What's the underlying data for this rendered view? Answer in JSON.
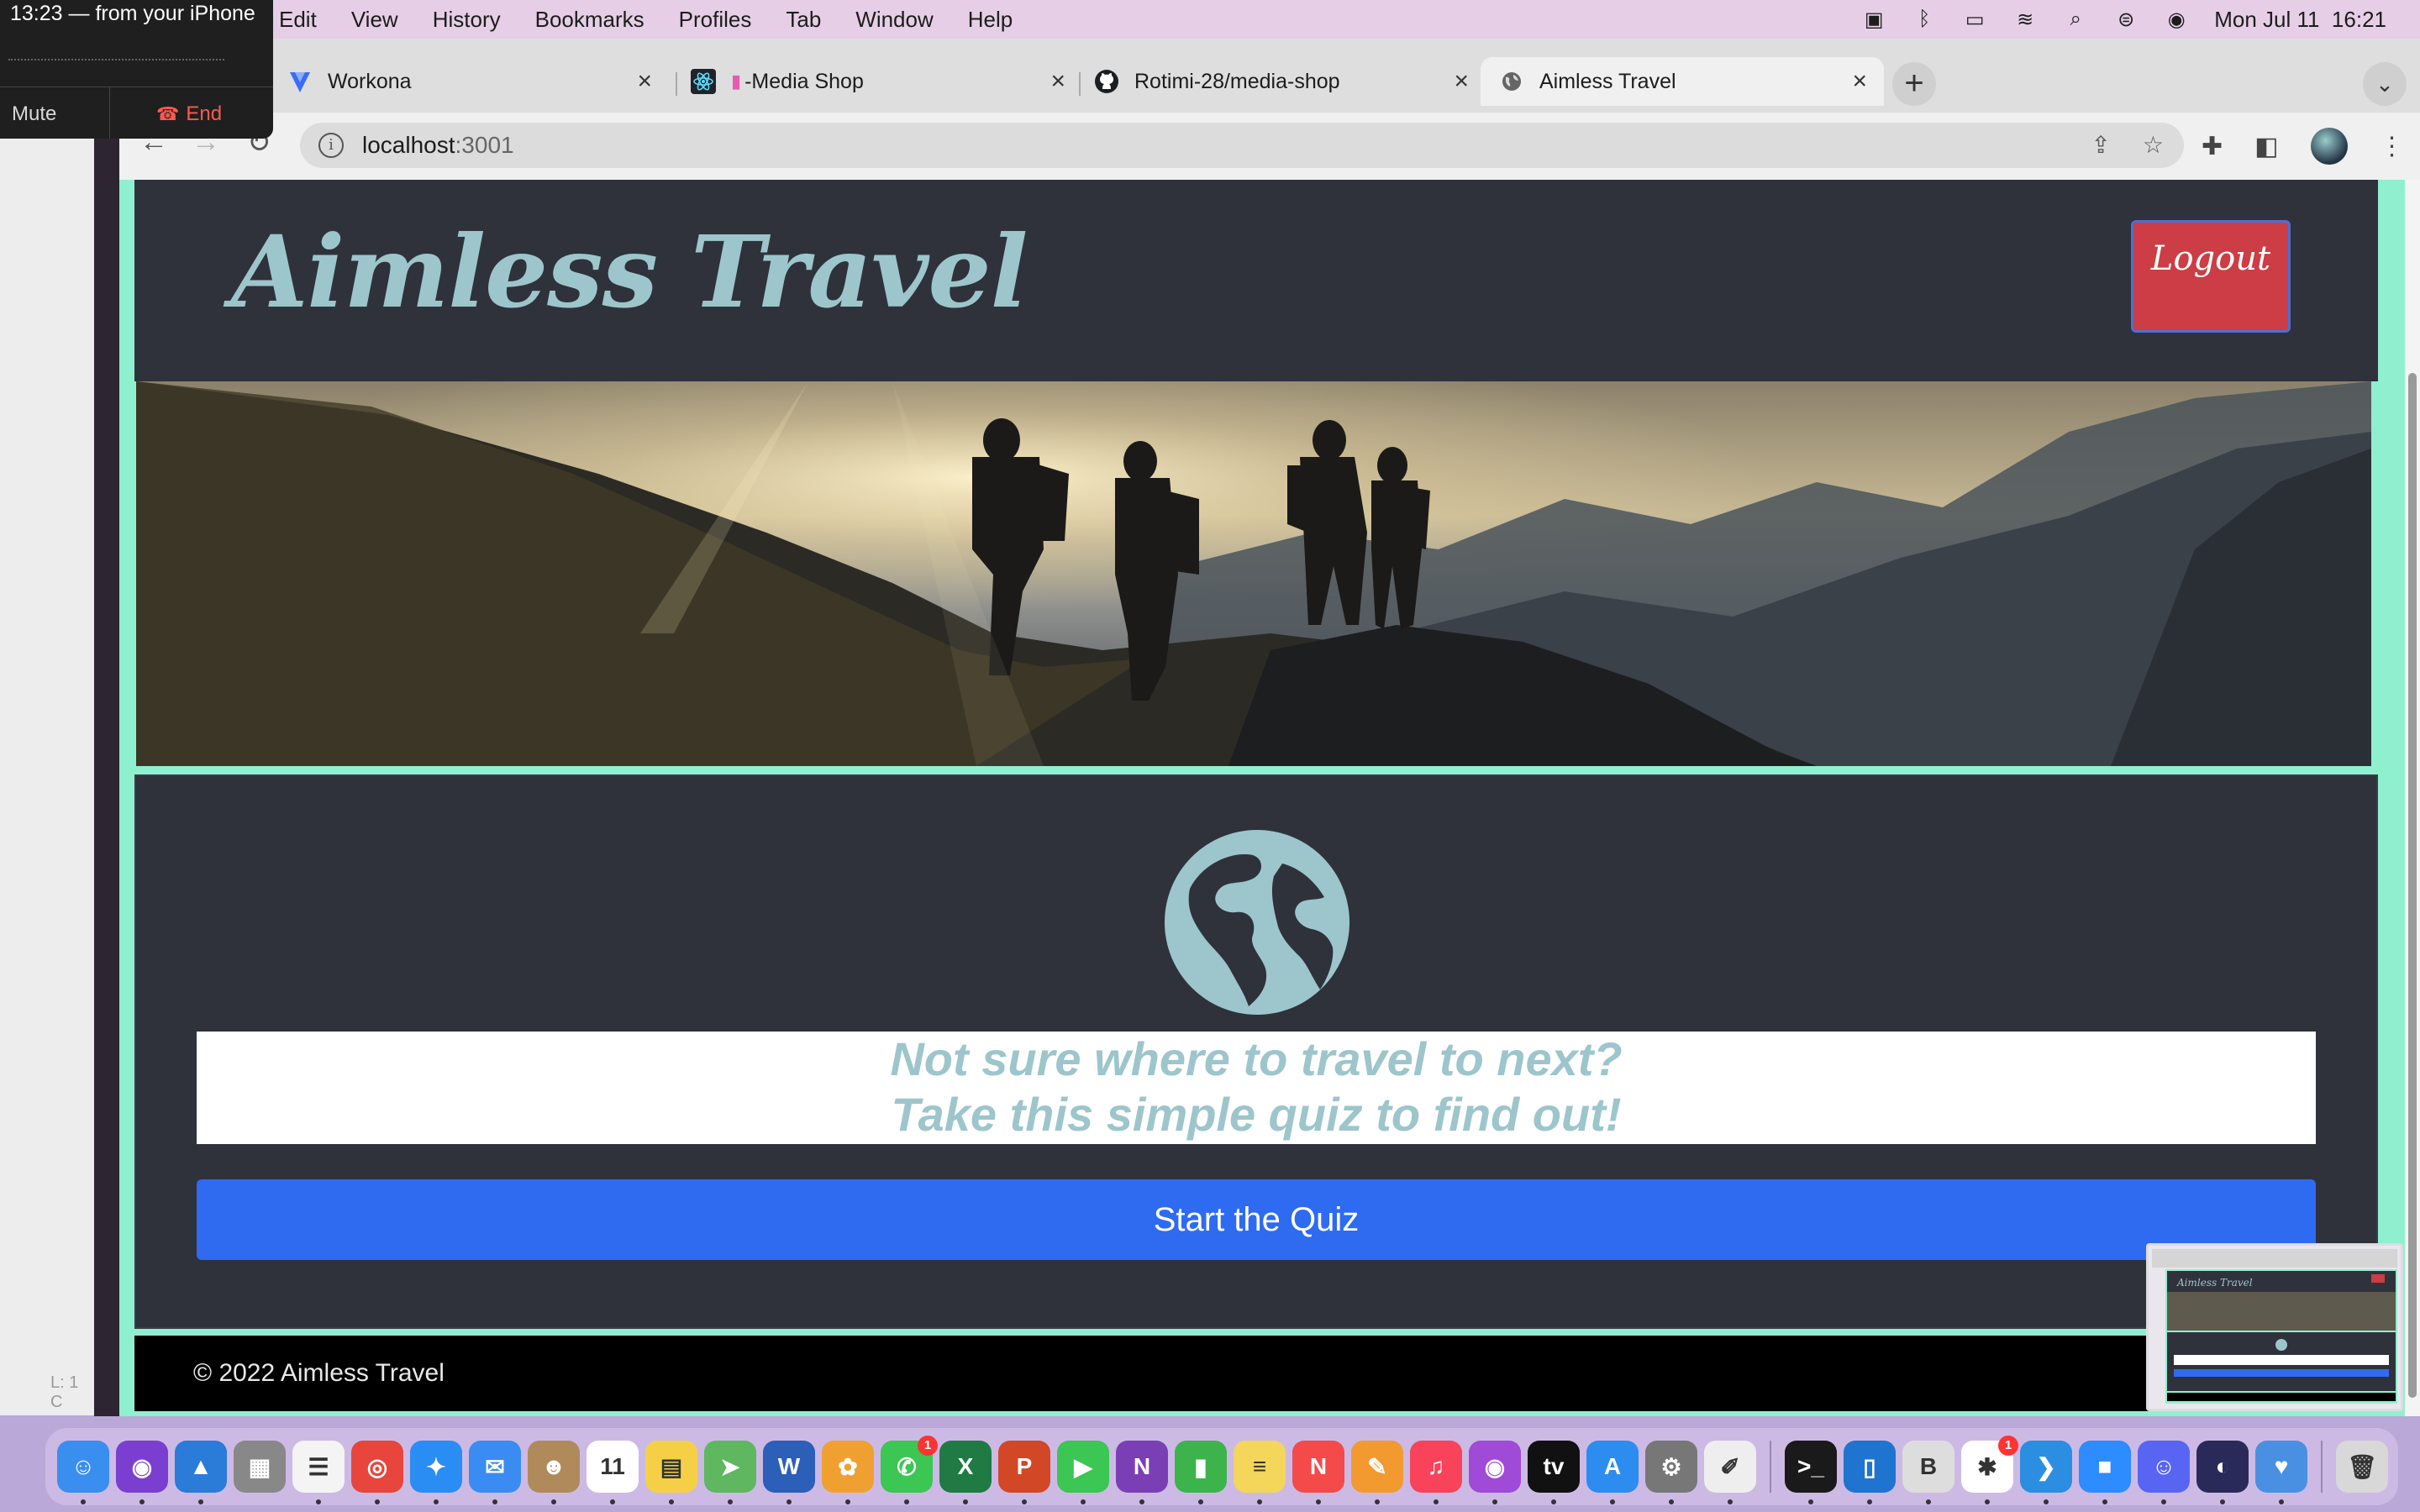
{
  "menubar": {
    "menus": [
      "Edit",
      "View",
      "History",
      "Bookmarks",
      "Profiles",
      "Tab",
      "Window",
      "Help"
    ],
    "datetime": "Mon Jul 11  16:21"
  },
  "call": {
    "caller": "13:23 — from your iPhone",
    "mute": "Mute",
    "end": "End"
  },
  "left_app": {
    "status": "L: 1 C"
  },
  "browser": {
    "tabs": [
      {
        "title": "Workona",
        "icon": "workona-icon"
      },
      {
        "title": "-Media Shop",
        "icon": "react-icon"
      },
      {
        "title": "Rotimi-28/media-shop",
        "icon": "github-icon"
      },
      {
        "title": "Aimless Travel",
        "icon": "globe-icon"
      }
    ],
    "url_host": "localhost",
    "url_port": ":3001"
  },
  "site": {
    "title": "Aimless Travel",
    "logout": "Logout",
    "quiz_line1": "Not sure where to travel to next?",
    "quiz_line2": "Take this simple quiz to find out!",
    "start_button": "Start the Quiz",
    "footer": "© 2022 Aimless Travel"
  },
  "pip": {
    "title": "Aimless Travel"
  },
  "dock": {
    "apps": [
      {
        "name": "finder",
        "color": "#3a8ef0",
        "glyph": "☺"
      },
      {
        "name": "siri",
        "color": "#7a3fd0",
        "glyph": "◉"
      },
      {
        "name": "keynote",
        "color": "#2b7bd8",
        "glyph": "▲"
      },
      {
        "name": "launchpad",
        "color": "#888",
        "glyph": "▦"
      },
      {
        "name": "reminders",
        "color": "#f4f4f4",
        "glyph": "☰"
      },
      {
        "name": "chrome",
        "color": "#e8453c",
        "glyph": "◎"
      },
      {
        "name": "safari",
        "color": "#2a8df4",
        "glyph": "✦"
      },
      {
        "name": "mail",
        "color": "#3b8cf2",
        "glyph": "✉"
      },
      {
        "name": "contacts",
        "color": "#b08a5a",
        "glyph": "☻"
      },
      {
        "name": "calendar",
        "color": "#ffffff",
        "glyph": "11"
      },
      {
        "name": "notes",
        "color": "#f5d046",
        "glyph": "▤"
      },
      {
        "name": "maps",
        "color": "#5fb760",
        "glyph": "➤"
      },
      {
        "name": "word",
        "color": "#2b5fb8",
        "glyph": "W"
      },
      {
        "name": "photos",
        "color": "#f0a030",
        "glyph": "✿"
      },
      {
        "name": "messages",
        "color": "#3cc653",
        "glyph": "✆",
        "badge": "1"
      },
      {
        "name": "excel",
        "color": "#1f7a44",
        "glyph": "X"
      },
      {
        "name": "powerpoint",
        "color": "#d24726",
        "glyph": "P"
      },
      {
        "name": "facetime",
        "color": "#3cc653",
        "glyph": "▶"
      },
      {
        "name": "onenote",
        "color": "#7b3fb5",
        "glyph": "N"
      },
      {
        "name": "numbers",
        "color": "#3cb44b",
        "glyph": "▮"
      },
      {
        "name": "stickies",
        "color": "#f3d65a",
        "glyph": "≡"
      },
      {
        "name": "news",
        "color": "#f44a4a",
        "glyph": "N"
      },
      {
        "name": "pages",
        "color": "#f29a30",
        "glyph": "✎"
      },
      {
        "name": "music",
        "color": "#f8435a",
        "glyph": "♫"
      },
      {
        "name": "podcasts",
        "color": "#a04ad8",
        "glyph": "◉"
      },
      {
        "name": "appletv",
        "color": "#111111",
        "glyph": "tv"
      },
      {
        "name": "appstore",
        "color": "#2d8cf0",
        "glyph": "A"
      },
      {
        "name": "systemprefs",
        "color": "#777",
        "glyph": "⚙"
      },
      {
        "name": "textedit",
        "color": "#eeeeee",
        "glyph": "✐"
      },
      {
        "name": "terminal",
        "color": "#1a1a1a",
        "glyph": ">_"
      },
      {
        "name": "trello",
        "color": "#1f74cf",
        "glyph": "▯"
      },
      {
        "name": "bbedit",
        "color": "#dddddd",
        "glyph": "B"
      },
      {
        "name": "slack",
        "color": "#ffffff",
        "glyph": "✱",
        "badge": "1"
      },
      {
        "name": "vscode",
        "color": "#2b8ee0",
        "glyph": "❯"
      },
      {
        "name": "zoom",
        "color": "#2d8cff",
        "glyph": "■"
      },
      {
        "name": "discord",
        "color": "#5865f2",
        "glyph": "☺"
      },
      {
        "name": "screenshot",
        "color": "#2a2a5a",
        "glyph": "◐"
      },
      {
        "name": "health",
        "color": "#4a90e2",
        "glyph": "♥"
      },
      {
        "name": "trash",
        "color": "#d8d8d8",
        "glyph": "🗑"
      }
    ]
  }
}
